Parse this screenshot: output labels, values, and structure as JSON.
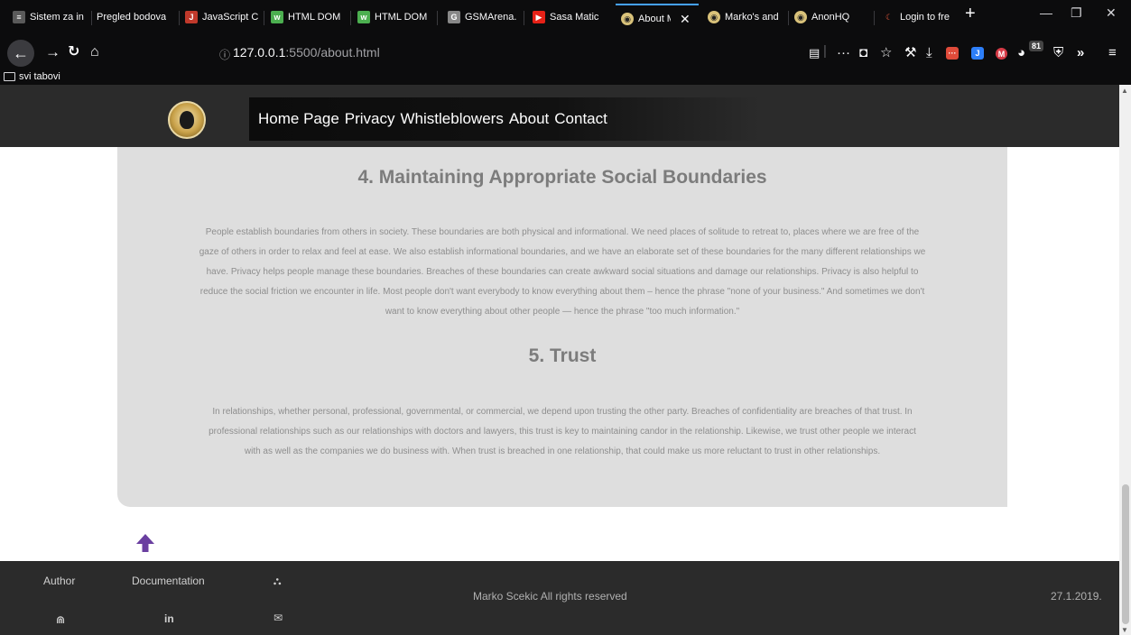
{
  "browser": {
    "tabs": [
      {
        "label": "Sistem za in",
        "color": "#5a5a5a"
      },
      {
        "label": "Pregled bodova",
        "color": "#0c0c0d"
      },
      {
        "label": "JavaScript C",
        "color": "#c0392b"
      },
      {
        "label": "HTML DOM",
        "color": "#4caf50"
      },
      {
        "label": "HTML DOM",
        "color": "#4caf50"
      },
      {
        "label": "GSMArena.",
        "color": "#888888"
      },
      {
        "label": "Sasa Matic",
        "color": "#e62117"
      },
      {
        "label": "About M",
        "color": "#d9c27a"
      },
      {
        "label": "Marko's and",
        "color": "#d9c27a"
      },
      {
        "label": "AnonHQ",
        "color": "#d9c27a"
      },
      {
        "label": "Login to fre",
        "color": "#e0563b"
      }
    ],
    "active_tab_close": "✕",
    "new_tab": "+",
    "url_host": "127.0.0.1",
    "url_path": ":5500/about.html",
    "badge_count": "81",
    "bookmark_folder": "svi tabovi"
  },
  "site": {
    "menu": [
      "Home Page",
      "Privacy",
      "Whistleblowers",
      "About",
      "Contact"
    ],
    "sections": [
      {
        "title": "4. Maintaining Appropriate Social Boundaries",
        "lines": [
          "People establish boundaries from others in society. These boundaries are both physical and informational. We need places of solitude to retreat to, places where we are free of the",
          "gaze of others in order to relax and feel at ease. We also establish informational boundaries, and we have an elaborate set of these boundaries for the many different relationships we",
          "have. Privacy helps people manage these boundaries. Breaches of these boundaries can create awkward social situations and damage our relationships. Privacy is also helpful to",
          "reduce the social friction we encounter in life. Most people don't want everybody to know everything about them – hence the phrase \"none of your business.\" And sometimes we don't",
          "want to know everything about other people — hence the phrase \"too much information.\""
        ]
      },
      {
        "title": "5. Trust",
        "lines": [
          "In relationships, whether personal, professional, governmental, or commercial, we depend upon trusting the other party. Breaches of confidentiality are breaches of that trust. In",
          "professional relationships such as our relationships with doctors and lawyers, this trust is key to maintaining candor in the relationship. Likewise, we trust other people we interact",
          "with as well as the companies we do business with. When trust is breached in one relationship, that could make us more reluctant to trust in other relationships."
        ]
      }
    ],
    "footer": {
      "author": "Author",
      "documentation": "Documentation",
      "copyright": "Marko Scekic All rights reserved",
      "date": "27.1.2019.",
      "linkedin": "in"
    },
    "accent": "#6a3fa0"
  }
}
